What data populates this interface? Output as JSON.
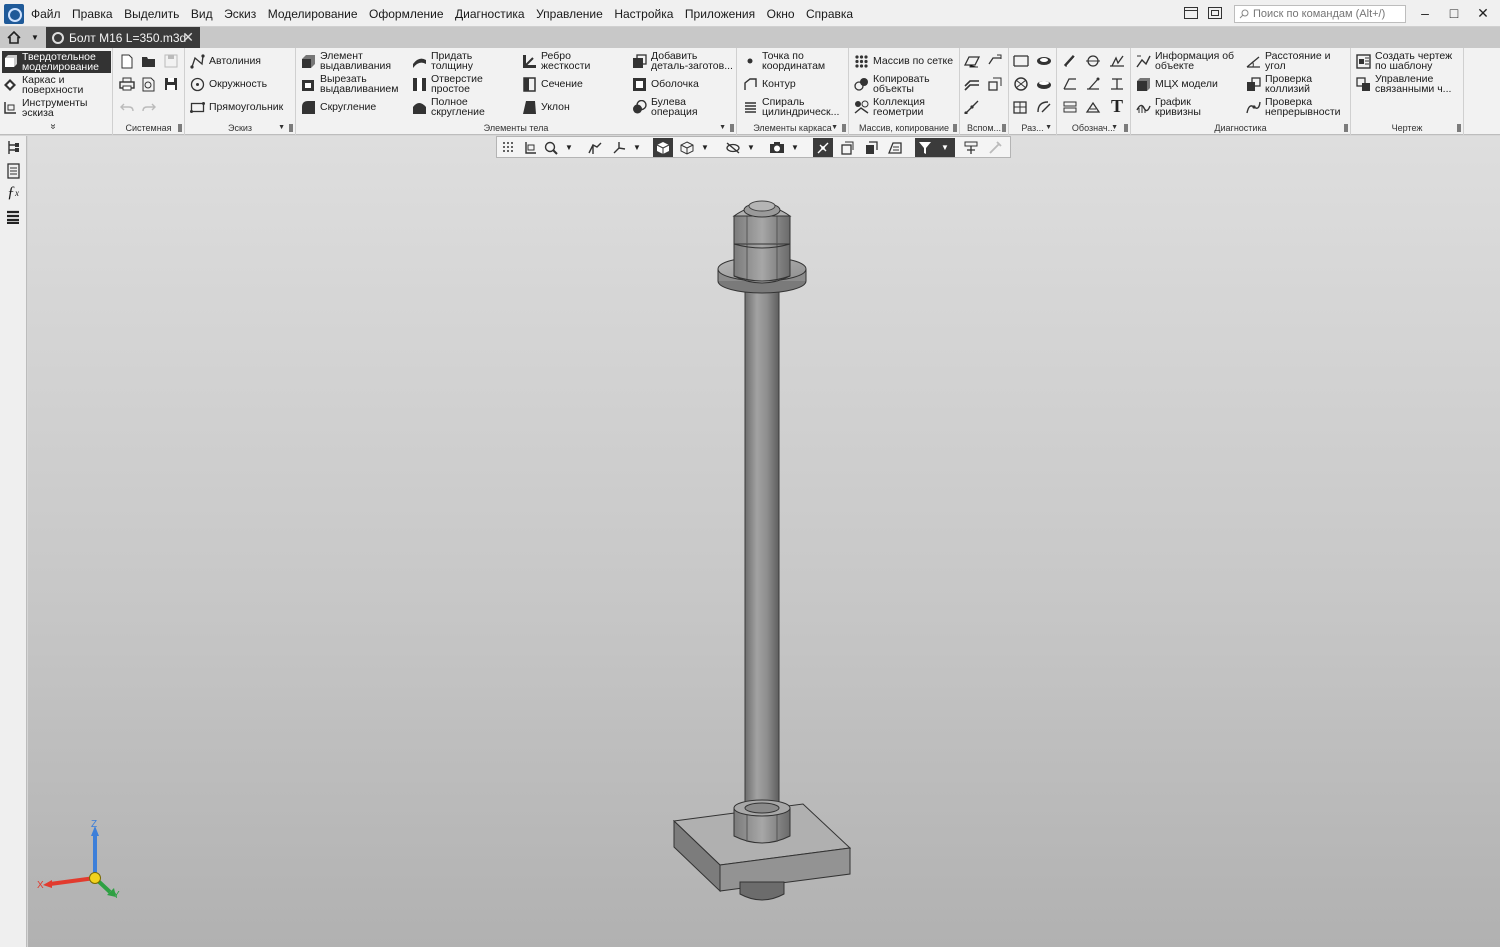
{
  "window": {
    "menu": [
      "Файл",
      "Правка",
      "Выделить",
      "Вид",
      "Эскиз",
      "Моделирование",
      "Оформление",
      "Диагностика",
      "Управление",
      "Настройка",
      "Приложения",
      "Окно",
      "Справка"
    ],
    "search_placeholder": "Поиск по командам (Alt+/)",
    "controls": {
      "minimize": "–",
      "maximize": "□",
      "close": "✕"
    }
  },
  "tabs": {
    "document": {
      "title": "Болт М16 L=350.m3d",
      "close": "✕"
    }
  },
  "ribbon": {
    "modes": [
      {
        "label": "Твердотельное\nмоделирование",
        "selected": true,
        "icon": "solid-modeling-icon"
      },
      {
        "label": "Каркас и\nповерхности",
        "selected": false,
        "icon": "surfaces-icon"
      },
      {
        "label": "Инструменты\nэскиза",
        "selected": false,
        "icon": "sketch-tools-icon"
      }
    ],
    "expand_glyph": "»",
    "groups": {
      "system": {
        "label": "Системная"
      },
      "sketch": {
        "label": "Эскиз",
        "buttons": [
          "Автолиния",
          "Окружность",
          "Прямоугольник"
        ]
      },
      "body": {
        "label": "Элементы тела",
        "buttons": [
          "Элемент\nвыдавливания",
          "Вырезать\nвыдавливанием",
          "Скругление",
          "Придать\nтолщину",
          "Отверстие\nпростое",
          "Полное\nскругление",
          "Ребро\nжесткости",
          "Сечение",
          "Уклон",
          "Добавить\nдеталь-заготов...",
          "Оболочка",
          "Булева\nоперация"
        ]
      },
      "frame": {
        "label": "Элементы каркаса",
        "buttons": [
          "Точка по\nкоординатам",
          "Контур",
          "Спираль\nцилиндрическ..."
        ]
      },
      "array": {
        "label": "Массив, копирование",
        "buttons": [
          "Массив по сетке",
          "Копировать\nобъекты",
          "Коллекция\nгеометрии"
        ]
      },
      "aux": {
        "label": "Вспом..."
      },
      "sizes": {
        "label": "Раз..."
      },
      "notation": {
        "label": "Обознач...",
        "text_tool": "T"
      },
      "diagnostics": {
        "label": "Диагностика",
        "buttons": [
          "Информация об\nобъекте",
          "МЦХ модели",
          "График\nкривизны",
          "Расстояние и\nугол",
          "Проверка\nколлизий",
          "Проверка\nнепрерывности"
        ]
      },
      "drawing": {
        "label": "Чертеж",
        "buttons": [
          "Создать чертеж\nпо шаблону",
          "Управление\nсвязанными ч..."
        ]
      }
    }
  },
  "viewport": {
    "model": "bolt-assembly",
    "triad": {
      "x": "X",
      "y": "Y",
      "z": "Z"
    },
    "colors": {
      "axis_x": "#e23b2e",
      "axis_y": "#2ea043",
      "axis_z": "#3d7fd9",
      "origin": "#f2d21c"
    }
  }
}
